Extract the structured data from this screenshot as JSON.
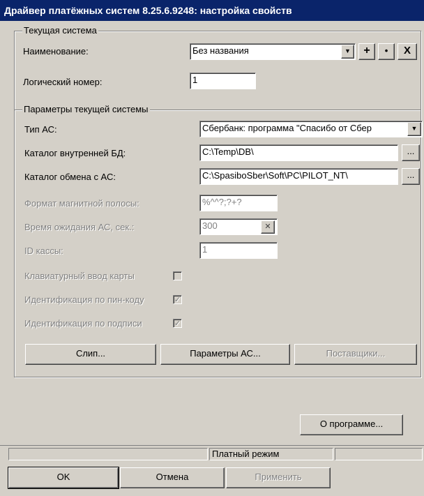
{
  "window": {
    "title": "Драйвер платёжных систем 8.25.6.9248: настройка свойств"
  },
  "current_system": {
    "legend": "Текущая система",
    "name_label": "Наименование:",
    "name_value": "Без названия",
    "add_label": "+",
    "dot_label": "•",
    "delete_label": "X",
    "logical_number_label": "Логический номер:",
    "logical_number_value": "1"
  },
  "params": {
    "legend": "Параметры текущей системы",
    "as_type_label": "Тип АС:",
    "as_type_value": "Сбербанк: программа \"Спасибо от Сбер",
    "db_dir_label": "Каталог внутренней БД:",
    "db_dir_value": "C:\\Temp\\DB\\",
    "exchange_dir_label": "Каталог обмена с АС:",
    "exchange_dir_value": "C:\\SpasiboSber\\Soft\\PC\\PILOT_NT\\",
    "browse_label": "...",
    "mag_format_label": "Формат магнитной полосы:",
    "mag_format_value": "%^^?;?+?",
    "timeout_label": "Время ожидания АС, сек.:",
    "timeout_value": "300",
    "cash_id_label": "ID кассы:",
    "cash_id_value": "1",
    "keyboard_input_label": "Клавиатурный ввод карты",
    "keyboard_input_checked": false,
    "pin_ident_label": "Идентификация по пин-коду",
    "pin_ident_checked": true,
    "sign_ident_label": "Идентификация по подписи",
    "sign_ident_checked": true,
    "check_mark": "✓",
    "slip_button": "Слип...",
    "as_params_button": "Параметры АС...",
    "suppliers_button": "Поставщики..."
  },
  "about_button": "О программе...",
  "status": {
    "cell1": "",
    "cell2": "Платный режим",
    "cell3": ""
  },
  "footer": {
    "ok": "OK",
    "cancel": "Отмена",
    "apply": "Применить"
  }
}
